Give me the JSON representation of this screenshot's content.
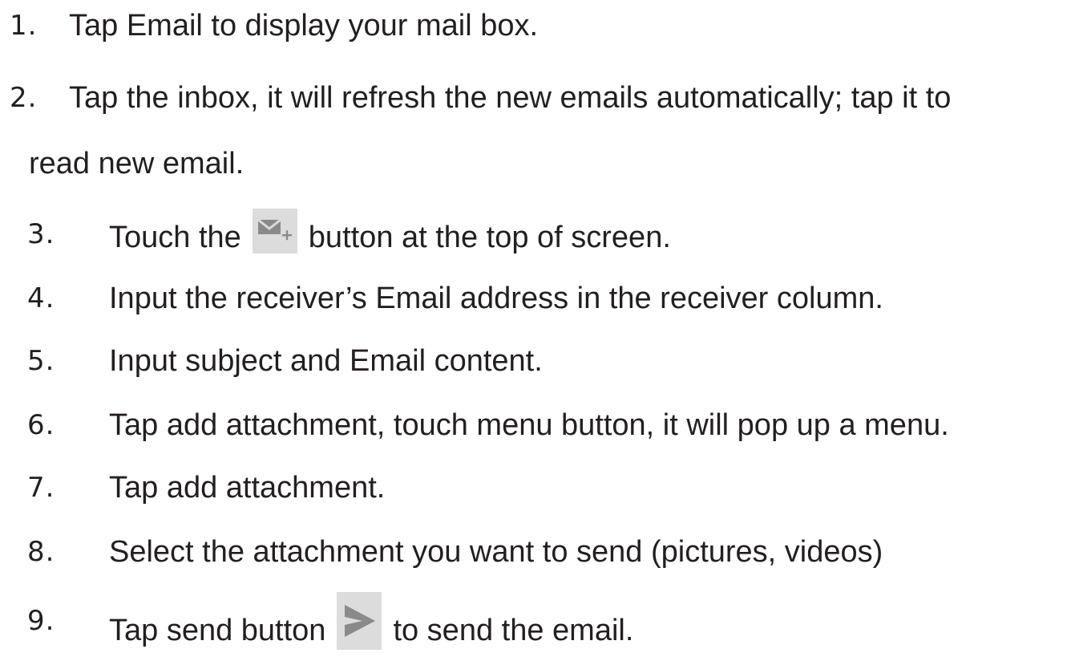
{
  "steps": [
    {
      "number": "1.",
      "text": "Tap Email to display your mail box."
    },
    {
      "number": "2.",
      "text": "Tap the inbox, it will refresh the new emails automatically; tap it to",
      "continuation": "read new email."
    },
    {
      "number": "3.",
      "text_before": "Touch the",
      "text_after": "button at the top of screen.",
      "icon": "compose-email-icon"
    },
    {
      "number": "4.",
      "text": "Input the receiver’s Email address in the receiver column."
    },
    {
      "number": "5.",
      "text": "Input subject and Email content."
    },
    {
      "number": "6.",
      "text": "Tap add attachment, touch menu button, it will pop up a menu."
    },
    {
      "number": "7.",
      "text": "Tap add attachment."
    },
    {
      "number": "8.",
      "text": "Select the attachment you want to send (pictures, videos)"
    },
    {
      "number": "9.",
      "text_before": "Tap send button",
      "text_after": "to send the email.",
      "icon": "send-icon"
    }
  ],
  "colors": {
    "text": "#231f20",
    "icon_background": "#dcdcdc",
    "icon_glyph": "#8a8a8a"
  }
}
